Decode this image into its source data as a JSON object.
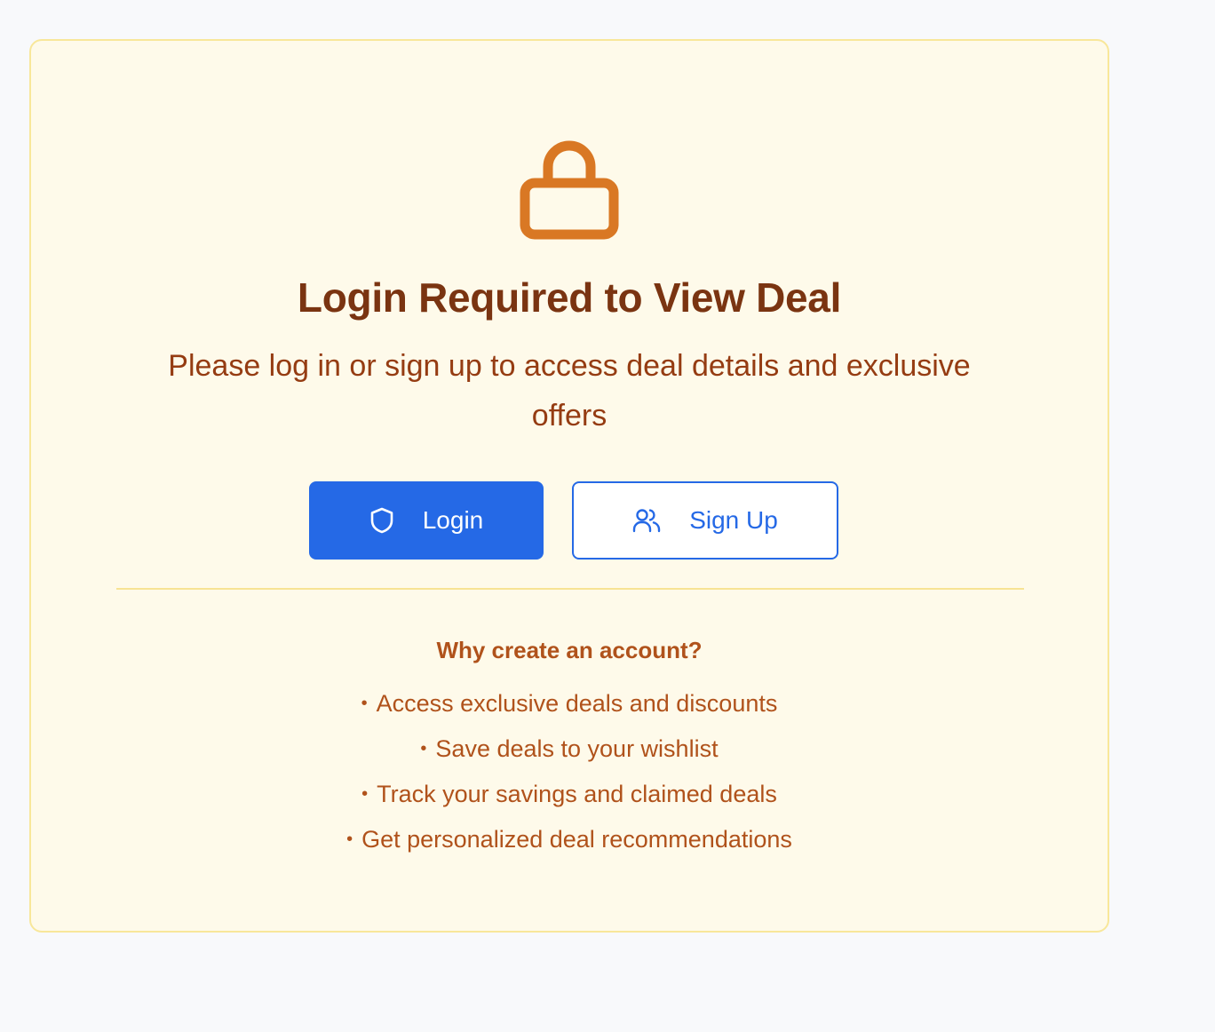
{
  "card": {
    "title": "Login Required to View Deal",
    "subtitle": "Please log in or sign up to access deal details and exclusive offers",
    "icon": "lock-icon"
  },
  "actions": {
    "login_label": "Login",
    "login_icon": "shield-icon",
    "signup_label": "Sign Up",
    "signup_icon": "users-icon"
  },
  "benefits": {
    "heading": "Why create an account?",
    "bullet": "•",
    "items": [
      "Access exclusive deals and discounts",
      "Save deals to your wishlist",
      "Track your savings and claimed deals",
      "Get personalized deal recommendations"
    ]
  },
  "colors": {
    "page_background": "#f8f9fb",
    "card_background": "#fefaea",
    "card_border": "#f8e79a",
    "lock": "#d97824",
    "title": "#7a3411",
    "subtitle": "#953c12",
    "benefit_text": "#b0521b",
    "primary": "#2569e6"
  }
}
